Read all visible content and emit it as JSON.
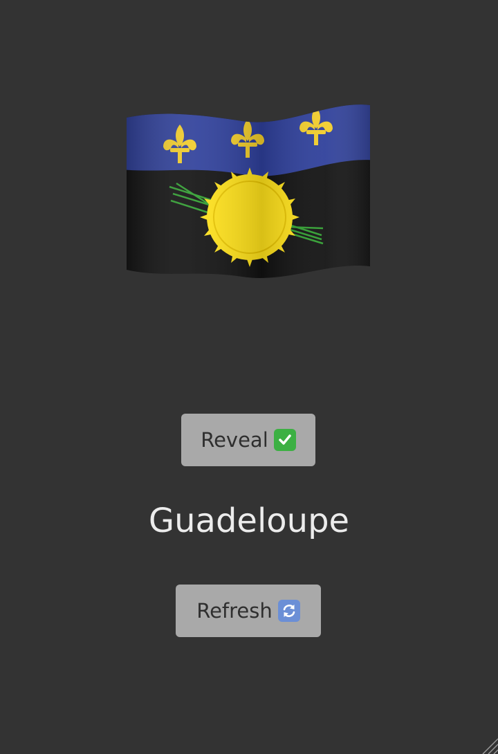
{
  "flag": {
    "icon": "guadeloupe-flag-emoji",
    "colors": {
      "blue": "#2e3f9a",
      "black": "#111111",
      "sun": "#ffe11a",
      "fleur": "#f2cd2a",
      "cane": "#2f9e2f"
    }
  },
  "reveal_button": {
    "label": "Reveal",
    "icon": "check-mark-button-icon"
  },
  "answer": {
    "country": "Guadeloupe"
  },
  "refresh_button": {
    "label": "Refresh",
    "icon": "refresh-arrows-icon"
  },
  "colors": {
    "background": "#333333",
    "button": "#a9a9a9",
    "button_text": "#2f2f2f",
    "answer_text": "#ececec"
  }
}
